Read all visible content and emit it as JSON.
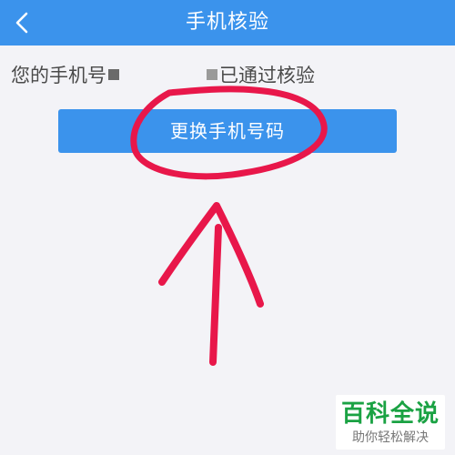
{
  "header": {
    "title": "手机核验",
    "back_icon": "chevron-left-icon",
    "bg_color": "#3b93ec"
  },
  "phone_status": {
    "prefix": "您的手机号",
    "suffix": "已通过核验"
  },
  "change_button": {
    "label": "更换手机号码",
    "bg_color": "#3b93ec"
  },
  "watermark": {
    "main": "百科全说",
    "sub": "助你轻松解决"
  },
  "annotation_color": "#e8174a"
}
